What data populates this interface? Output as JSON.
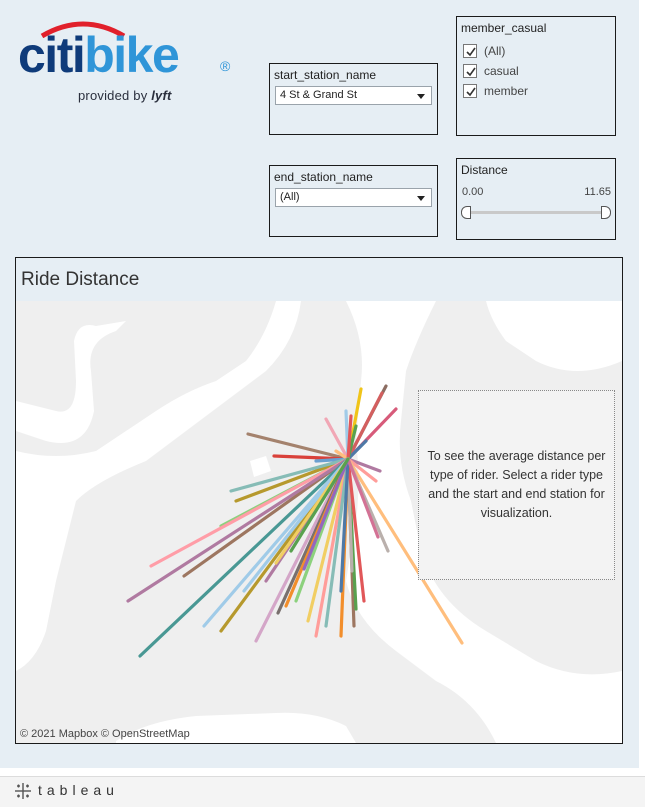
{
  "brand": {
    "logo_citi": "citi",
    "logo_bike": "bike",
    "logo_reg": "®",
    "provided_prefix": "provided by",
    "provided_brand": "lyft",
    "colors": {
      "navy": "#0f3b7a",
      "blue": "#2f95d8",
      "red": "#e1202b"
    }
  },
  "filters": {
    "start_station": {
      "label": "start_station_name",
      "value": "4 St & Grand St"
    },
    "end_station": {
      "label": "end_station_name",
      "value": "(All)"
    },
    "member_casual": {
      "label": "member_casual",
      "options": [
        {
          "label": "(All)",
          "checked": true
        },
        {
          "label": "casual",
          "checked": true
        },
        {
          "label": "member",
          "checked": true
        }
      ]
    },
    "distance": {
      "label": "Distance",
      "min": "0.00",
      "max": "11.65"
    }
  },
  "viz": {
    "title": "Ride Distance",
    "note": "To see the average distance per type of rider.  Select a rider type and the start and end station for visualization.",
    "attribution": "© 2021 Mapbox  © OpenStreetMap"
  },
  "footer": {
    "brand": "tableau"
  }
}
